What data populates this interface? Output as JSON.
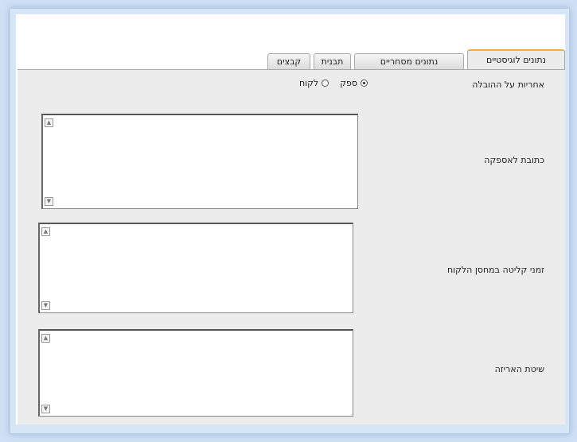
{
  "tabs": [
    {
      "label": "קבצים",
      "active": false
    },
    {
      "label": "תבנית",
      "active": false
    },
    {
      "label": "נתונים מסחריים",
      "active": false
    },
    {
      "label": "נתונים לוגיסטיים",
      "active": true
    }
  ],
  "form": {
    "delivery_responsibility_label": "אחריות על ההובלה",
    "radio_supplier_label": "ספק",
    "radio_customer_label": "לקוח",
    "selected_option": "ספק",
    "supply_address_label": "כתובת לאספקה",
    "supply_address_value": "",
    "warehouse_times_label": "זמני קליטה במחסן הלקוח",
    "warehouse_times_value": "",
    "packing_method_label": "שיטת האריזה",
    "packing_method_value": ""
  },
  "colors": {
    "page_bg": "#cfe0f4",
    "panel_bg": "#ececec",
    "active_tab_accent": "#f0b040"
  }
}
